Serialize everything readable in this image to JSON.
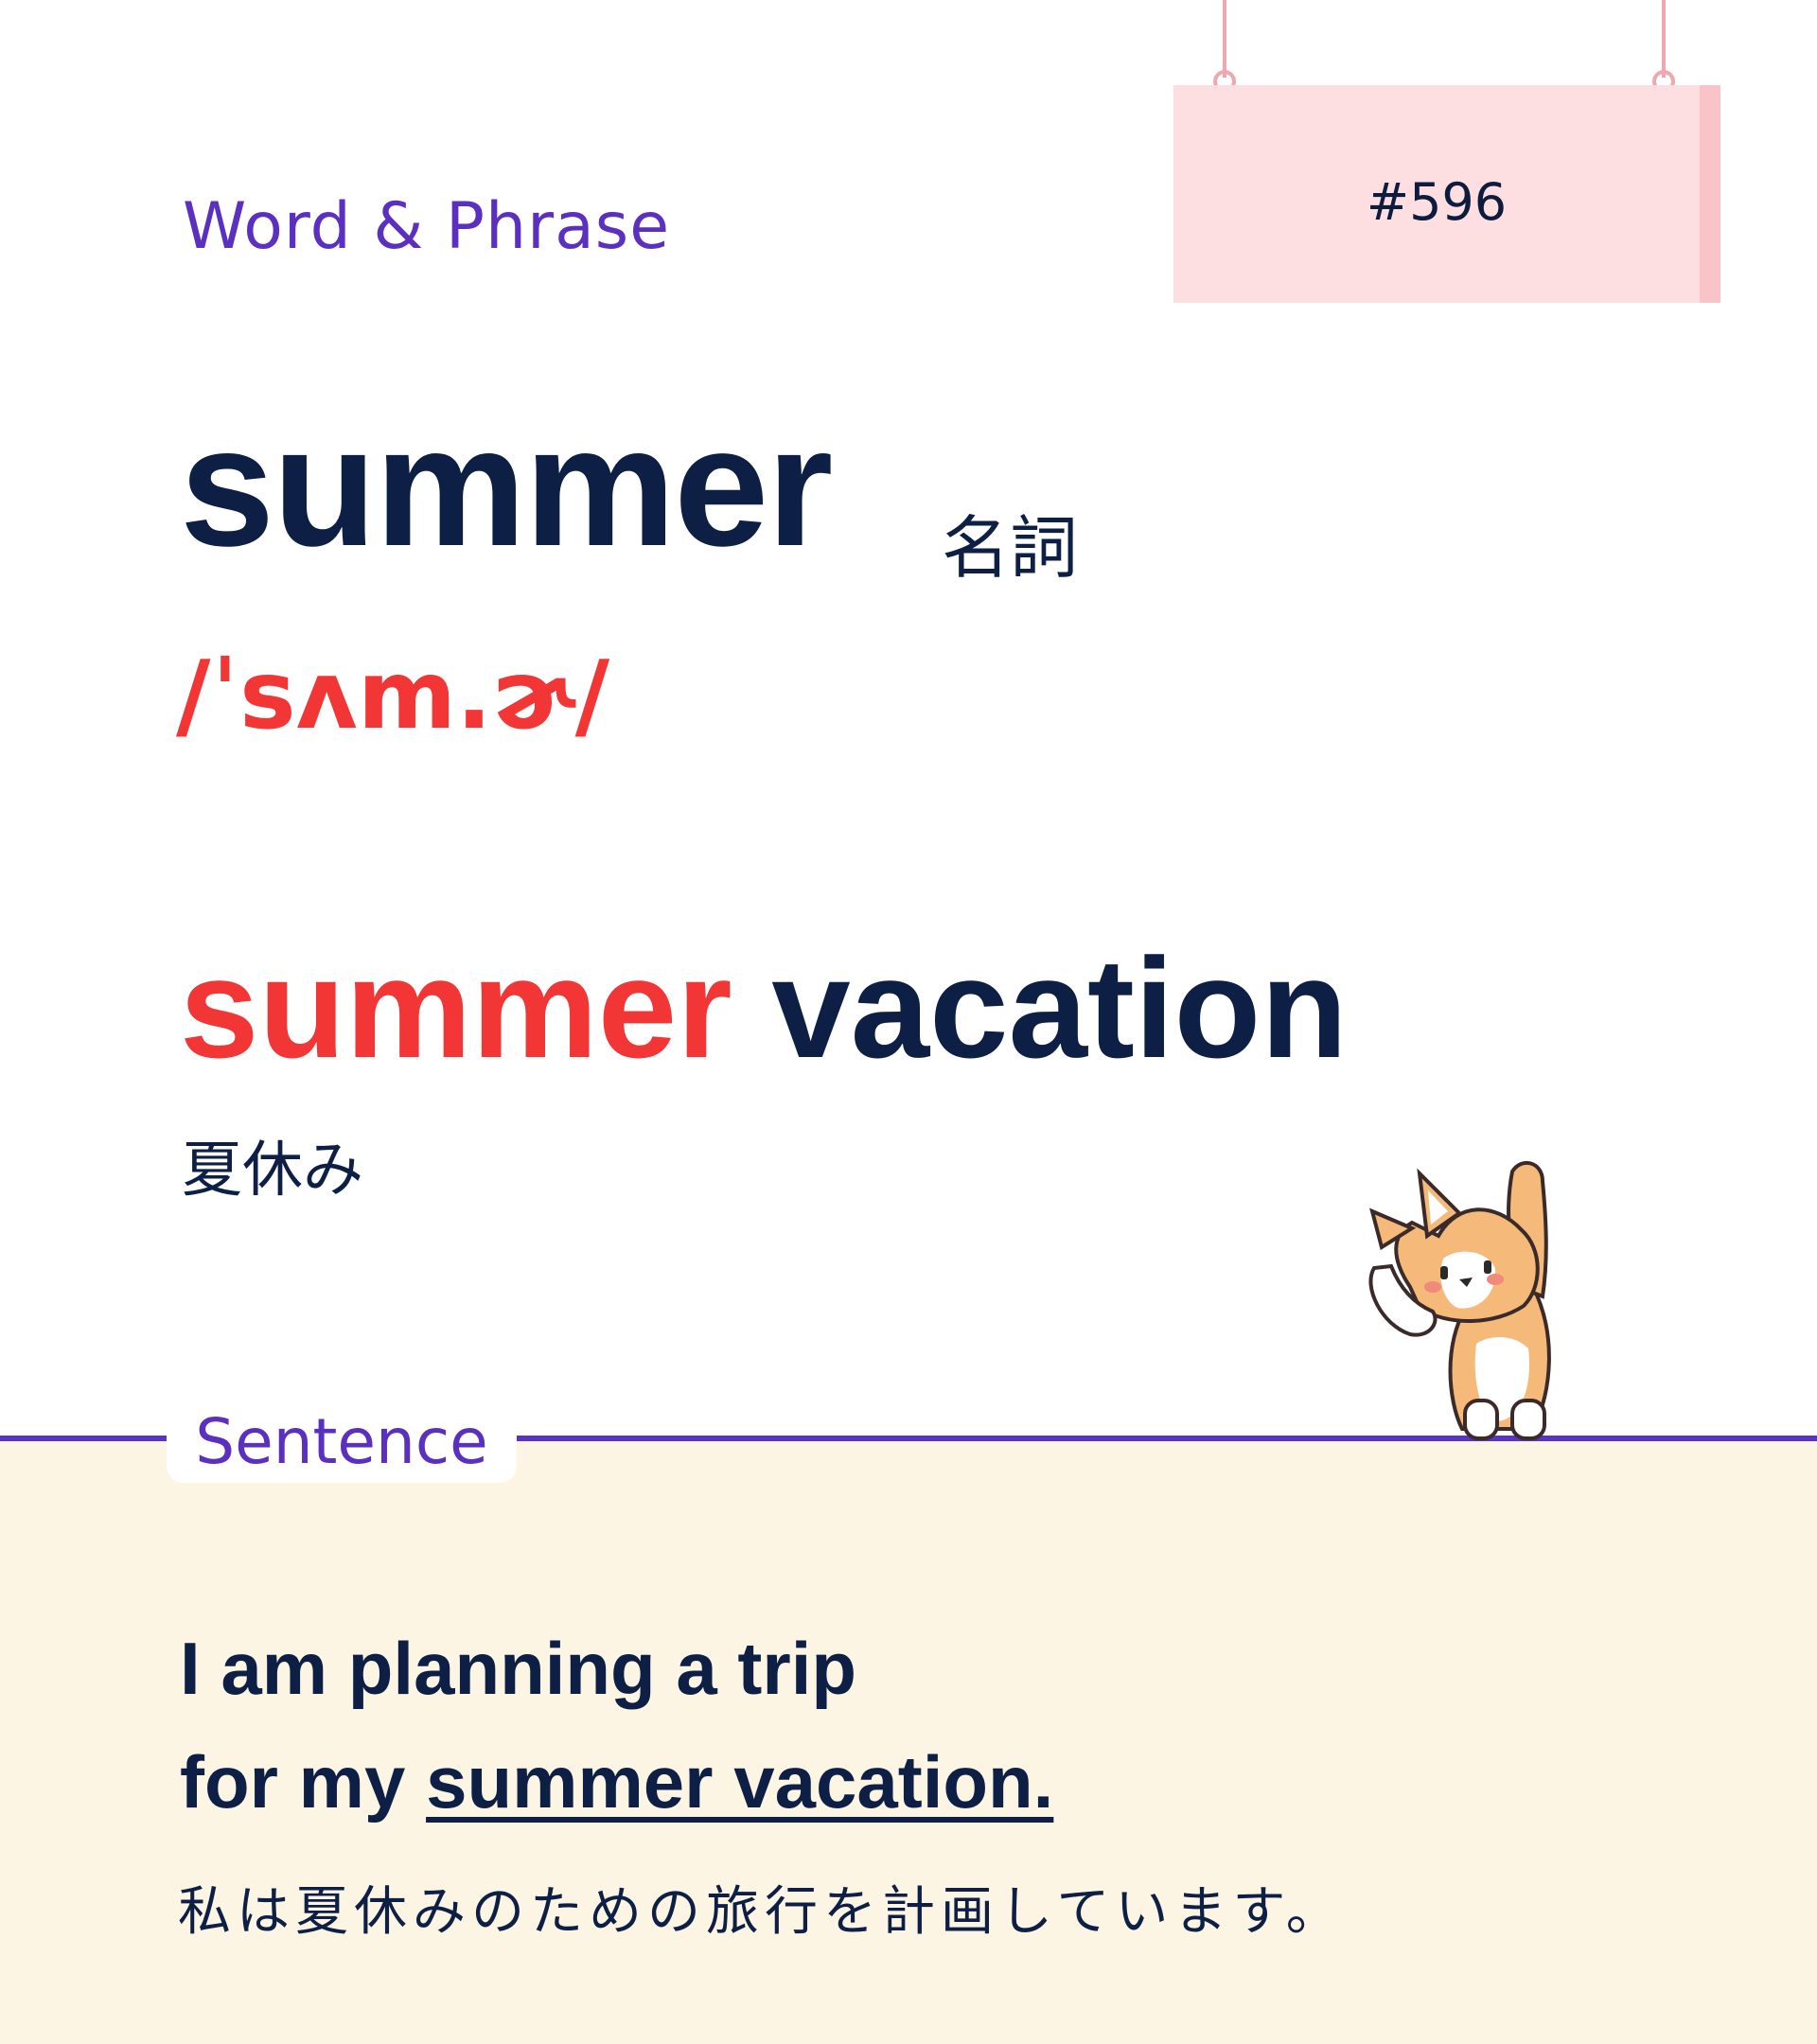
{
  "header": {
    "section_label": "Word & Phrase",
    "card_number": "#596"
  },
  "word": {
    "headword": "summer",
    "part_of_speech": "名詞",
    "pronunciation": "/ˈsʌm.ɚ/"
  },
  "phrase": {
    "highlight": "summer",
    "rest": " vacation",
    "translation": "夏休み"
  },
  "sentence": {
    "section_label": "Sentence",
    "line1": "I am planning a trip",
    "line2_prefix": "for my ",
    "line2_underlined": "summer vacation.",
    "translation": "私は夏休みのための旅行を計画しています。"
  },
  "colors": {
    "accent_purple": "#5b2fc0",
    "highlight_red": "#f23535",
    "navy_text": "#0d1f45",
    "sign_pink": "#fddfe2",
    "sentence_bg": "#fdf5e4"
  },
  "icons": {
    "mascot": "corgi-mascot-icon"
  }
}
